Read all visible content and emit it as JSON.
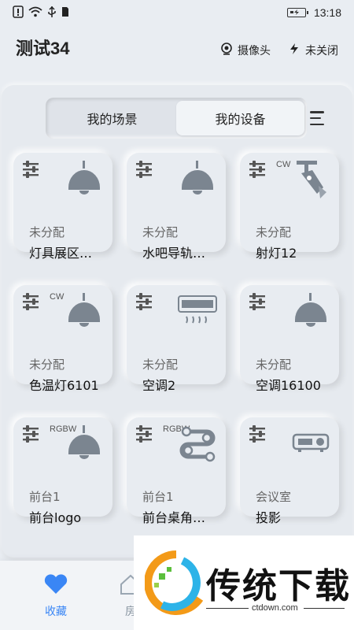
{
  "status": {
    "time": "13:18"
  },
  "header": {
    "title": "测试34",
    "camera_label": "摄像头",
    "power_label": "未关闭"
  },
  "tabs": [
    {
      "label": "我的场景"
    },
    {
      "label": "我的设备"
    }
  ],
  "devices": [
    {
      "tag": "",
      "room": "未分配",
      "name": "灯具展区…",
      "icon": "pendant-lamp-icon"
    },
    {
      "tag": "",
      "room": "未分配",
      "name": "水吧导轨…",
      "icon": "pendant-lamp-icon"
    },
    {
      "tag": "CW",
      "room": "未分配",
      "name": "射灯12",
      "icon": "spotlight-icon"
    },
    {
      "tag": "CW",
      "room": "未分配",
      "name": "色温灯6101",
      "icon": "pendant-lamp-icon"
    },
    {
      "tag": "",
      "room": "未分配",
      "name": "空调2",
      "icon": "air-conditioner-icon"
    },
    {
      "tag": "",
      "room": "未分配",
      "name": "空调16100",
      "icon": "pendant-lamp-icon"
    },
    {
      "tag": "RGBW",
      "room": "前台1",
      "name": "前台logo",
      "icon": "pendant-lamp-icon"
    },
    {
      "tag": "RGBW",
      "room": "前台1",
      "name": "前台桌角…",
      "icon": "light-strip-icon"
    },
    {
      "tag": "",
      "room": "会议室",
      "name": "投影",
      "icon": "projector-icon"
    }
  ],
  "nav": [
    {
      "label": "收藏"
    },
    {
      "label": "房"
    }
  ],
  "ad": {
    "title": "传统下载",
    "url": "ctdown.com"
  },
  "colors": {
    "accent": "#3a86f5",
    "icon_gray": "#7b8590"
  }
}
